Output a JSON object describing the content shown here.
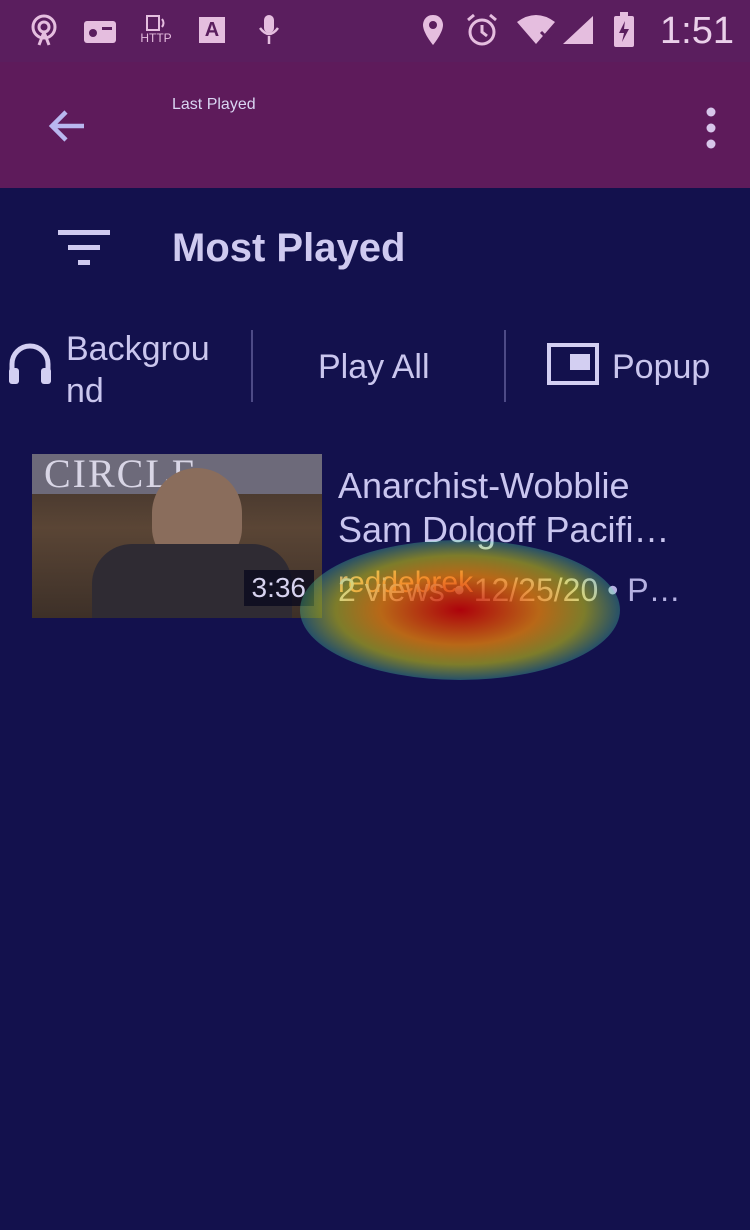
{
  "status_bar": {
    "time": "1:51",
    "icons": [
      "hotspot-icon",
      "radio-icon",
      "http-icon",
      "keyboard-a-icon",
      "mic-icon",
      "location-icon",
      "alarm-icon",
      "wifi-icon",
      "signal-icon",
      "battery-charging-icon"
    ],
    "http_label": "HTTP",
    "a_label": "A"
  },
  "appbar": {
    "title": "Last Played"
  },
  "sort": {
    "label": "Most Played"
  },
  "actions": {
    "background_label_line1": "Backgrou",
    "background_label_line2": "nd",
    "play_all_label": "Play All",
    "popup_label": "Popup"
  },
  "videos": [
    {
      "title_line1": "Anarchist-Wobblie",
      "title_line2": "Sam Dolgoff Pacifi…",
      "uploader": "reddebrek",
      "meta": "2 views • 12/25/20 • P…",
      "duration": "3:36",
      "thumb_text": "CIRCLE"
    }
  ],
  "colors": {
    "background": "#13114d",
    "appbar": "#5e1b5b"
  }
}
